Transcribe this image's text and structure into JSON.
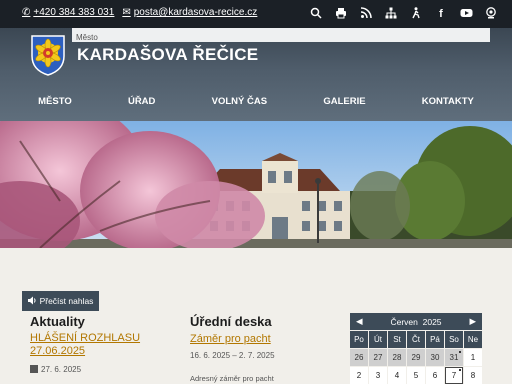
{
  "topbar": {
    "phone": "+420 384 383 031",
    "email": "posta@kardasova-recice.cz",
    "icons": [
      "search-icon",
      "print-icon",
      "rss-icon",
      "sitemap-icon",
      "accessibility-icon",
      "facebook-icon",
      "youtube-icon",
      "webcam-icon"
    ]
  },
  "header": {
    "label": "Město",
    "title": "KARDAŠOVA ŘEČICE"
  },
  "nav": [
    "MĚSTO",
    "ÚŘAD",
    "VOLNÝ ČAS",
    "GALERIE",
    "KONTAKTY"
  ],
  "read_aloud": "Přečíst nahlas",
  "news": {
    "heading": "Aktuality",
    "item_title": "HLÁŠENÍ ROZHLASU 27.06.2025",
    "item_date": "27. 6. 2025"
  },
  "board": {
    "heading": "Úřední deska",
    "item_title": "Záměr pro pacht",
    "item_dates": "16. 6. 2025 – 2. 7. 2025",
    "item_desc": "Adresný záměr pro pacht"
  },
  "calendar": {
    "month": "Červen",
    "year": "2025",
    "weekdays": [
      "Po",
      "Út",
      "St",
      "Čt",
      "Pá",
      "So",
      "Ne"
    ],
    "row1": [
      "26",
      "27",
      "28",
      "29",
      "30",
      "31",
      "1"
    ],
    "row2": [
      "2",
      "3",
      "4",
      "5",
      "6",
      "7",
      "8"
    ]
  },
  "colors": {
    "dark": "#1b2026",
    "header": "#4f5d6b",
    "accent_link": "#b27700",
    "button": "#3d4b58"
  }
}
